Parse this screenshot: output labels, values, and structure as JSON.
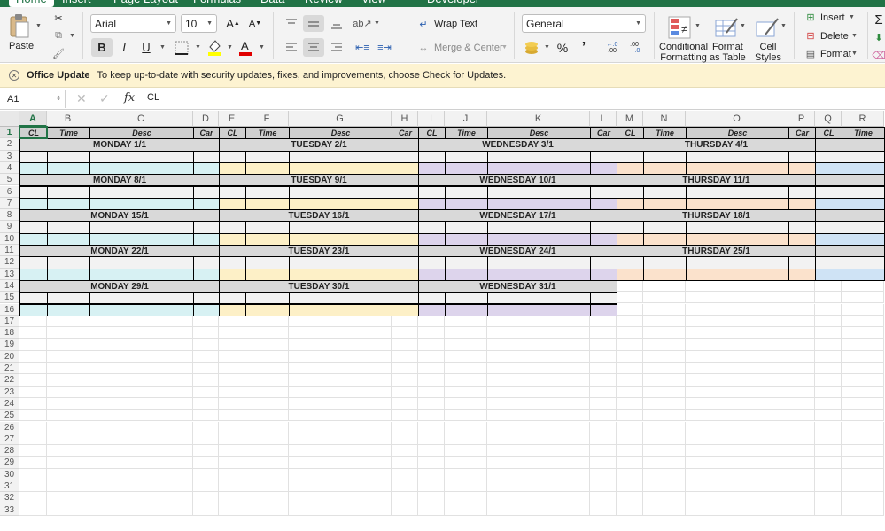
{
  "tabs": [
    "Home",
    "Insert",
    "Page Layout",
    "Formulas",
    "Data",
    "Review",
    "View",
    "Developer"
  ],
  "ribbon": {
    "paste_label": "Paste",
    "font_name": "Arial",
    "font_size": "10",
    "wrap_text": "Wrap Text",
    "merge_center": "Merge & Center",
    "number_format": "General",
    "percent": "%",
    "comma": "’",
    "inc_decimal_top": "←.0",
    "inc_decimal_bottom": ".00",
    "dec_decimal_top": ".00",
    "dec_decimal_bottom": "→.0",
    "conditional_formatting_1": "Conditional",
    "conditional_formatting_2": "Formatting",
    "format_as_table_1": "Format",
    "format_as_table_2": "as Table",
    "cell_styles_1": "Cell",
    "cell_styles_2": "Styles",
    "insert": "Insert",
    "delete": "Delete",
    "format": "Format",
    "bold": "B",
    "italic": "I",
    "underline": "U"
  },
  "message_bar": {
    "title": "Office Update",
    "text": "To keep up-to-date with security updates, fixes, and improvements, choose Check for Updates."
  },
  "formula_bar": {
    "name_box": "A1",
    "fx": "fx",
    "content": "CL"
  },
  "columns": [
    "A",
    "B",
    "C",
    "D",
    "E",
    "F",
    "G",
    "H",
    "I",
    "J",
    "K",
    "L",
    "M",
    "N",
    "O",
    "P",
    "Q",
    "R"
  ],
  "rows": [
    "1",
    "2",
    "3",
    "4",
    "5",
    "6",
    "7",
    "8",
    "9",
    "10",
    "11",
    "12",
    "13",
    "14",
    "15",
    "16",
    "17",
    "18",
    "19",
    "20",
    "21",
    "22",
    "23",
    "24",
    "25",
    "26",
    "27",
    "28",
    "29",
    "30",
    "31",
    "32",
    "33"
  ],
  "header_row": [
    "CL",
    "Time",
    "Desc",
    "Car",
    "CL",
    "Time",
    "Desc",
    "Car",
    "CL",
    "Time",
    "Desc",
    "Car",
    "CL",
    "Time",
    "Desc",
    "Car",
    "CL",
    "Time"
  ],
  "weeks": [
    [
      "MONDAY 1/1",
      "TUESDAY 2/1",
      "WEDNESDAY 3/1",
      "THURSDAY 4/1"
    ],
    [
      "MONDAY 8/1",
      "TUESDAY 9/1",
      "WEDNESDAY 10/1",
      "THURSDAY 11/1"
    ],
    [
      "MONDAY 15/1",
      "TUESDAY 16/1",
      "WEDNESDAY 17/1",
      "THURSDAY 18/1"
    ],
    [
      "MONDAY 22/1",
      "TUESDAY 23/1",
      "WEDNESDAY 24/1",
      "THURSDAY 25/1"
    ],
    [
      "MONDAY 29/1",
      "TUESDAY 30/1",
      "WEDNESDAY 31/1",
      ""
    ]
  ],
  "day_colors": [
    "#d7f1f3",
    "#fdf0c7",
    "#ddd4ec",
    "#fbe2cc",
    "#cfe3f5"
  ],
  "colors": {
    "accent": "#217346",
    "message_bar": "#fdf3d1",
    "header_fill": "#cfcfcf",
    "day_fill": "#d9d9d9",
    "blank_row_fill": "#f2f2f2"
  }
}
